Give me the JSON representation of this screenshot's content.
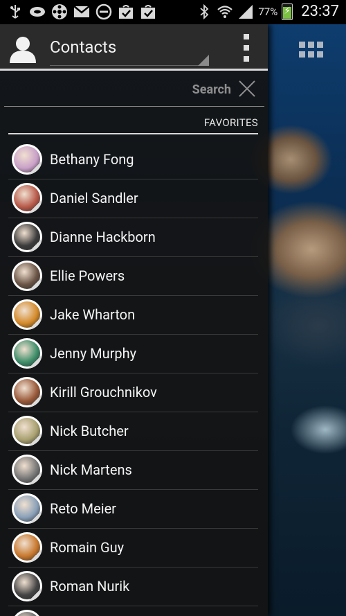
{
  "status_bar": {
    "left_icons": [
      "usb-icon",
      "message-icon",
      "media-icon",
      "gmail-icon",
      "block-icon",
      "bag-check-icon",
      "bag-check-icon"
    ],
    "battery_percent": "77%",
    "time": "23:37"
  },
  "header": {
    "title": "Contacts"
  },
  "search": {
    "placeholder": "Search"
  },
  "favorites": {
    "label": "FAVORITES"
  },
  "contacts": [
    {
      "name": "Bethany Fong",
      "avatar_color": "#c9a0c8"
    },
    {
      "name": "Daniel Sandler",
      "avatar_color": "#b85a4a"
    },
    {
      "name": "Dianne Hackborn",
      "avatar_color": "#3c3c3c"
    },
    {
      "name": "Ellie Powers",
      "avatar_color": "#6a5446"
    },
    {
      "name": "Jake Wharton",
      "avatar_color": "#d48a2a"
    },
    {
      "name": "Jenny Murphy",
      "avatar_color": "#3e8e6a"
    },
    {
      "name": "Kirill Grouchnikov",
      "avatar_color": "#9a5a3a"
    },
    {
      "name": "Nick Butcher",
      "avatar_color": "#a8a070"
    },
    {
      "name": "Nick Martens",
      "avatar_color": "#777777"
    },
    {
      "name": "Reto Meier",
      "avatar_color": "#8aa0b8"
    },
    {
      "name": "Romain Guy",
      "avatar_color": "#c8782e"
    },
    {
      "name": "Roman Nurik",
      "avatar_color": "#444444"
    },
    {
      "name": "",
      "avatar_color": "#666666"
    }
  ],
  "colors": {
    "accent": "#d8d8d8",
    "drawer_bg": "#141414",
    "battery": "#7cc242"
  }
}
